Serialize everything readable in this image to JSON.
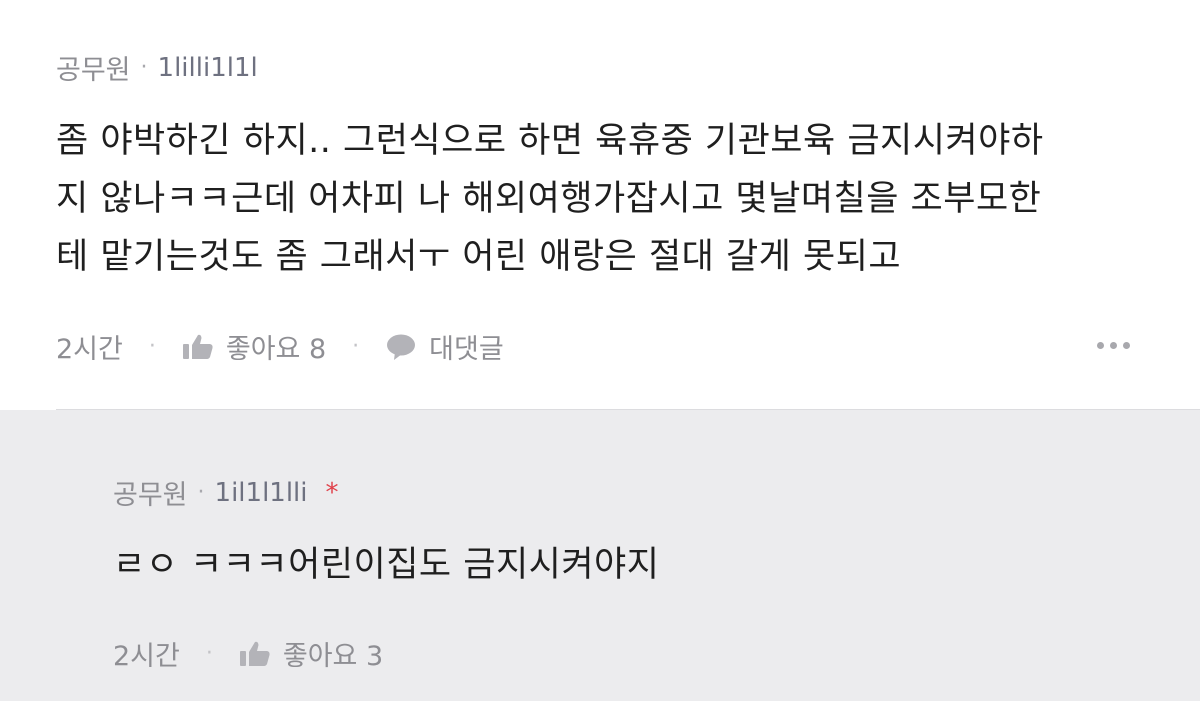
{
  "comment": {
    "author": "공무원",
    "user_id": "1lilli1l1l",
    "text": "좀 야박하긴 하지.. 그런식으로 하면 육휴중 기관보육 금지시켜야하\n지 않나ㅋㅋ근데 어차피 나 해외여행가잡시고 몇날며칠을 조부모한\n테 맡기는것도 좀 그래서ㅜ 어린 애랑은 절대 갈게 못되고",
    "time": "2시간",
    "like_label": "좋아요 8",
    "reply_label": "대댓글",
    "more_icon": "more-dots-icon"
  },
  "reply": {
    "author": "공무원",
    "user_id": "1il1l1lli",
    "author_marker": "*",
    "text": "ㄹㅇ ㅋㅋㅋ어린이집도 금지시켜야지",
    "time": "2시간",
    "like_label": "좋아요 3"
  },
  "colors": {
    "reply_background": "#ececee",
    "author_marker": "#e0404a",
    "meta_text": "#8e8e93"
  }
}
